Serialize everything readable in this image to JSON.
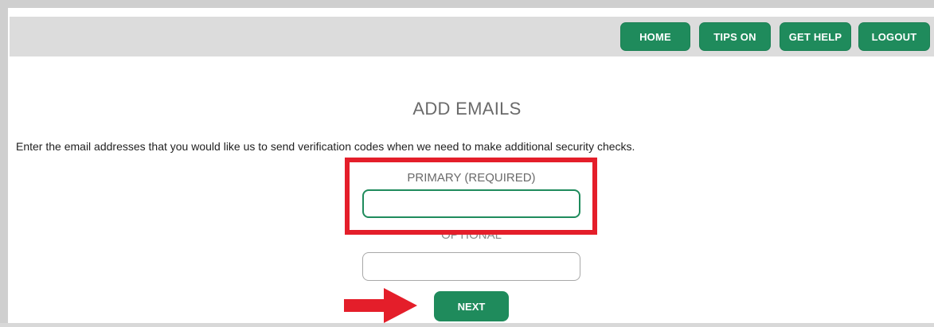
{
  "header": {
    "nav": [
      {
        "id": "home",
        "label": "HOME"
      },
      {
        "id": "tips",
        "label": "TIPS ON"
      },
      {
        "id": "help",
        "label": "GET HELP"
      },
      {
        "id": "logout",
        "label": "LOGOUT"
      }
    ]
  },
  "main": {
    "title": "ADD EMAILS",
    "instructions": "Enter the email addresses that you would like us to send verification codes when we need to make additional security checks.",
    "fields": {
      "primary": {
        "label": "PRIMARY (REQUIRED)",
        "value": "",
        "placeholder": ""
      },
      "optional": {
        "label": "OPTIONAL",
        "value": "",
        "placeholder": ""
      }
    },
    "next_label": "NEXT"
  },
  "annotations": {
    "highlight_color": "#e41e2a",
    "arrow_color": "#e41e2a"
  },
  "colors": {
    "brand_green": "#1f8b5c",
    "topbar_bg": "#dcdcdc"
  }
}
